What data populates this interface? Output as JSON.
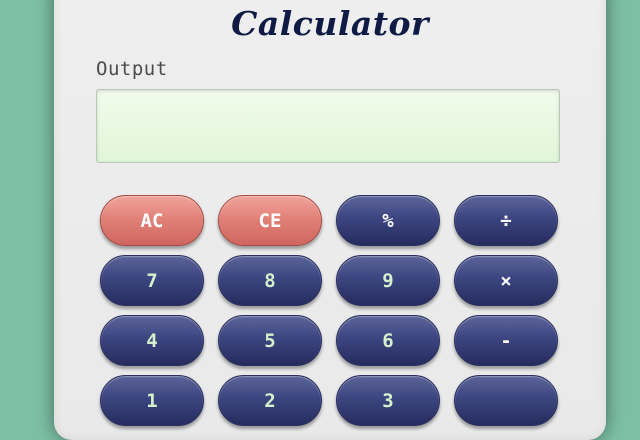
{
  "app": {
    "title": "Calculator",
    "output_label": "Output",
    "output_value": ""
  },
  "keys": [
    {
      "label": "AC",
      "name": "ac-button",
      "style": "red"
    },
    {
      "label": "CE",
      "name": "ce-button",
      "style": "red"
    },
    {
      "label": "%",
      "name": "percent-button",
      "style": "op"
    },
    {
      "label": "÷",
      "name": "divide-button",
      "style": "op"
    },
    {
      "label": "7",
      "name": "key-7-button",
      "style": "num"
    },
    {
      "label": "8",
      "name": "key-8-button",
      "style": "num"
    },
    {
      "label": "9",
      "name": "key-9-button",
      "style": "num"
    },
    {
      "label": "×",
      "name": "multiply-button",
      "style": "op"
    },
    {
      "label": "4",
      "name": "key-4-button",
      "style": "num"
    },
    {
      "label": "5",
      "name": "key-5-button",
      "style": "num"
    },
    {
      "label": "6",
      "name": "key-6-button",
      "style": "num"
    },
    {
      "label": "-",
      "name": "subtract-button",
      "style": "op"
    },
    {
      "label": "1",
      "name": "key-1-button",
      "style": "num"
    },
    {
      "label": "2",
      "name": "key-2-button",
      "style": "num"
    },
    {
      "label": "3",
      "name": "key-3-button",
      "style": "num"
    },
    {
      "label": "",
      "name": "add-button",
      "style": "op"
    }
  ],
  "colors": {
    "background": "#7dbfa6",
    "panel": "#eeeeee",
    "key_dark": "#3c4580",
    "key_red": "#e07f76",
    "output_bg": "#e6f7df",
    "title": "#0f1a45"
  }
}
